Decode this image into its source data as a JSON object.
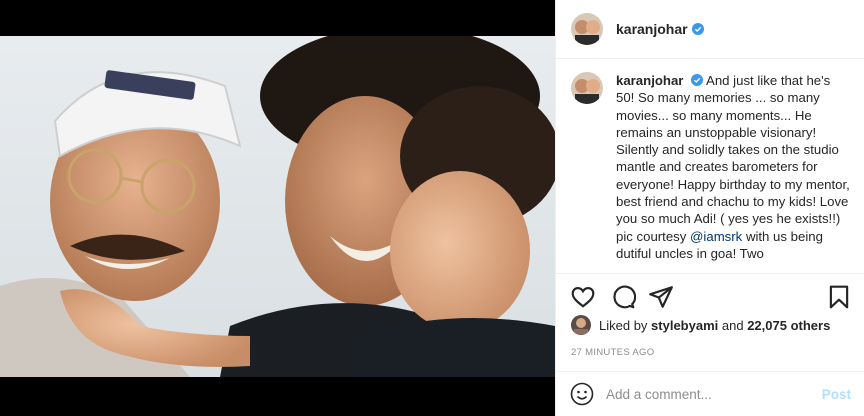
{
  "post": {
    "username": "karanjohar",
    "verified_icon": "verified-badge-icon",
    "caption_username": "karanjohar",
    "caption_text": "And just like that he's 50! So many memories ... so many movies... so many moments... He remains an unstoppable visionary! Silently and solidly takes on the studio mantle and creates barometers for everyone! Happy birthday to my mentor, best friend and chachu to my kids! Love you so much Adi! ( yes yes he exists!!) pic courtesy",
    "caption_mention": "@iamsrk",
    "caption_tail": "with us being dutiful uncles in goa! Two",
    "liked_by_prefix": "Liked by",
    "liked_by_user": "stylebyami",
    "liked_by_and": "and",
    "liked_by_count": "22,075 others",
    "timestamp": "27 MINUTES AGO"
  },
  "actions": {
    "like_icon": "heart-icon",
    "comment_icon": "comment-icon",
    "share_icon": "share-icon",
    "save_icon": "bookmark-icon"
  },
  "comment": {
    "placeholder": "Add a comment...",
    "post_label": "Post",
    "emoji_icon": "emoji-icon"
  },
  "colors": {
    "verified": "#3897f0",
    "mention": "#00376b",
    "post_button_disabled": "#b2dffc"
  }
}
